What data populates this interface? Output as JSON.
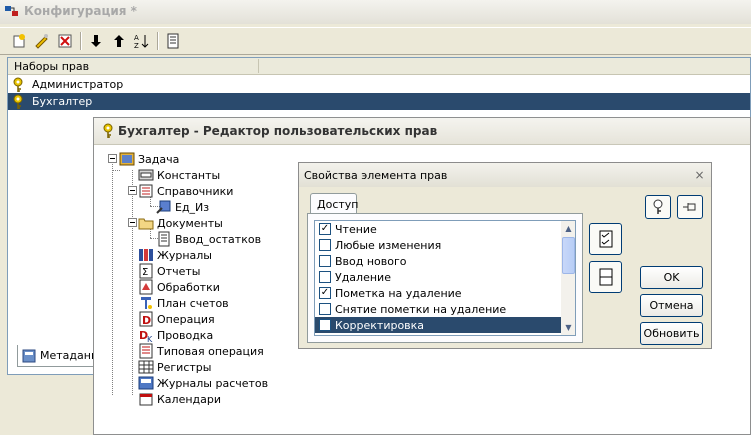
{
  "main_window": {
    "title": "Конфигурация *",
    "rights_header": "Наборы прав",
    "rights_sets": [
      {
        "label": "Администратор",
        "selected": false
      },
      {
        "label": "Бухгалтер",
        "selected": true
      }
    ],
    "bottom_tab": "Метаданны"
  },
  "editor": {
    "title": "Бухгалтер - Редактор пользовательских прав",
    "tree": {
      "root": "Задача",
      "konst": "Константы",
      "sprav": "Справочники",
      "ed_iz": "Ед_Из",
      "docs": "Документы",
      "vvod": "Ввод_остатков",
      "journals": "Журналы",
      "reports": "Отчеты",
      "processing": "Обработки",
      "chart_accounts": "План счетов",
      "operation": "Операция",
      "posting": "Проводка",
      "typical_op": "Типовая операция",
      "registers": "Регистры",
      "calc_journals": "Журналы расчетов",
      "calendars": "Календари"
    }
  },
  "dialog": {
    "title": "Свойства элемента прав",
    "close_icon": "×",
    "tab": "Доступ",
    "permissions": [
      {
        "label": "Чтение",
        "checked": true,
        "selected": false
      },
      {
        "label": "Любые изменения",
        "checked": false,
        "selected": false
      },
      {
        "label": "Ввод нового",
        "checked": false,
        "selected": false
      },
      {
        "label": "Удаление",
        "checked": false,
        "selected": false
      },
      {
        "label": "Пометка на удаление",
        "checked": true,
        "selected": false
      },
      {
        "label": "Снятие пометки на удаление",
        "checked": false,
        "selected": false
      },
      {
        "label": "Корректировка",
        "checked": true,
        "selected": true
      }
    ],
    "buttons": {
      "ok": "OK",
      "cancel": "Отмена",
      "refresh": "Обновить"
    },
    "check_mark": "✓"
  },
  "colors": {
    "selection": "#2a4a6d",
    "xp_border": "#003c74"
  }
}
